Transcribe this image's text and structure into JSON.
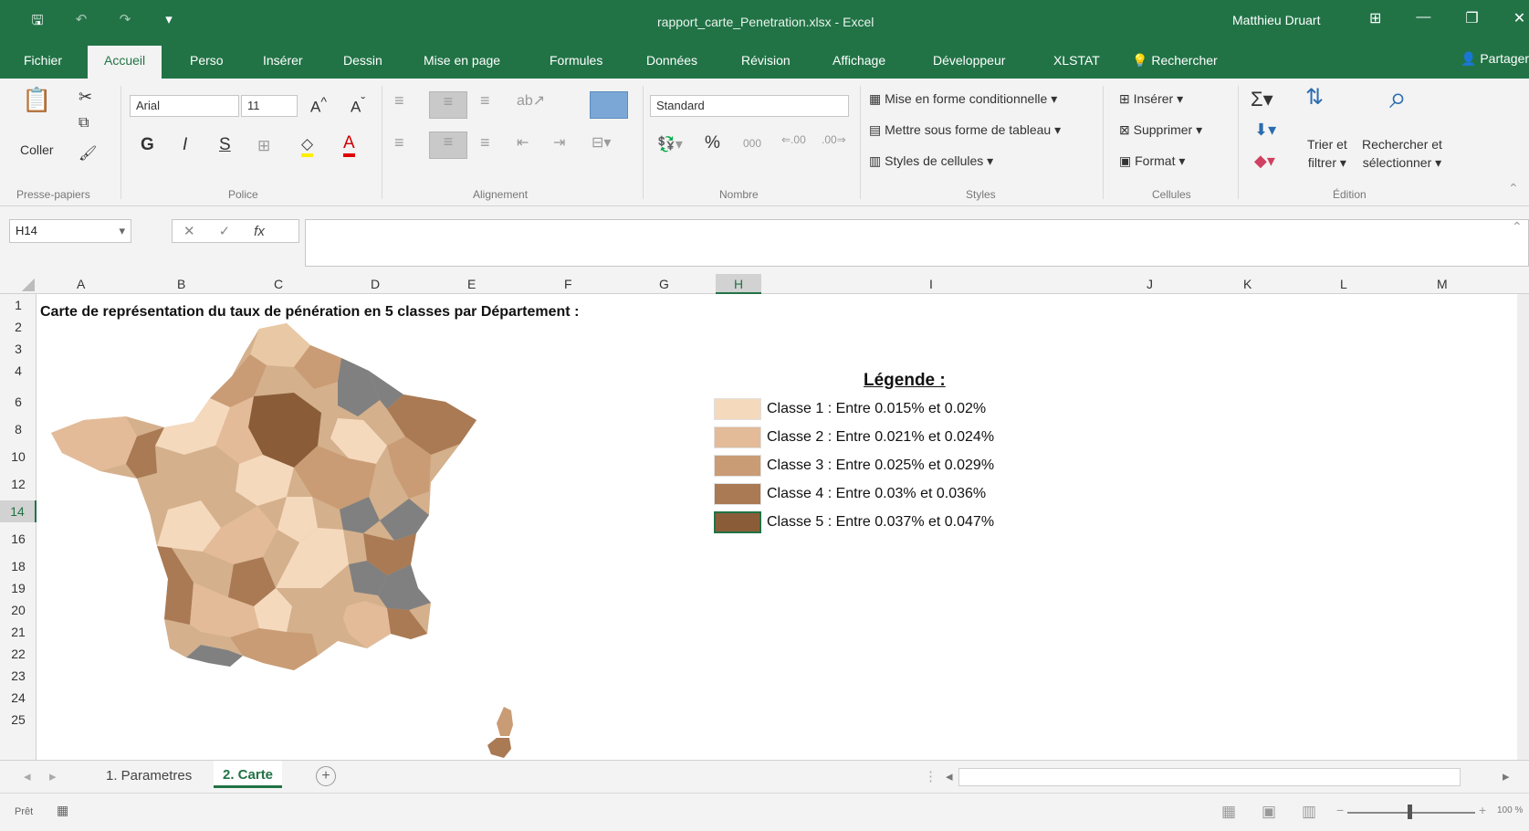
{
  "titlebar": {
    "document_title": "rapport_carte_Penetration.xlsx - Excel",
    "user_name": "Matthieu Druart",
    "qat_icons": [
      "save-icon",
      "undo-icon",
      "redo-icon",
      "customize-icon"
    ]
  },
  "menu": {
    "tabs": [
      "Fichier",
      "Accueil",
      "Perso",
      "Insérer",
      "Dessin",
      "Mise en page",
      "Formules",
      "Données",
      "Révision",
      "Affichage",
      "Développeur",
      "XLSTAT"
    ],
    "active_tab": "Accueil",
    "search_label": "Rechercher",
    "share_label": "Partager"
  },
  "ribbon": {
    "clipboard": {
      "paste_label": "Coller",
      "group_label": "Presse-papiers"
    },
    "font": {
      "name": "Arial",
      "size": "11",
      "bold": "G",
      "italic": "I",
      "underline": "S",
      "group_label": "Police"
    },
    "alignment": {
      "group_label": "Alignement"
    },
    "number": {
      "format": "Standard",
      "percent": "%",
      "thousands": "000",
      "group_label": "Nombre"
    },
    "styles": {
      "conditional": "Mise en forme conditionnelle",
      "as_table": "Mettre sous forme de tableau",
      "cell_styles": "Styles de cellules",
      "group_label": "Styles"
    },
    "cells": {
      "insert": "Insérer",
      "delete": "Supprimer",
      "format": "Format",
      "group_label": "Cellules"
    },
    "editing": {
      "sort_line1": "Trier et",
      "sort_line2": "filtrer",
      "find_line1": "Rechercher et",
      "find_line2": "sélectionner",
      "group_label": "Édition"
    }
  },
  "formula_bar": {
    "cell_ref": "H14",
    "formula": ""
  },
  "grid": {
    "columns": [
      "A",
      "B",
      "C",
      "D",
      "E",
      "F",
      "G",
      "H",
      "I",
      "J",
      "K",
      "L",
      "M"
    ],
    "rows": [
      "1",
      "2",
      "3",
      "4",
      "6",
      "8",
      "10",
      "12",
      "14",
      "16",
      "18",
      "19",
      "20",
      "21",
      "22",
      "23",
      "24",
      "25"
    ],
    "selected_row": "14",
    "title": "Carte de représentation du taux de pénération en 5 classes par Département :"
  },
  "legend": {
    "title": "Légende :",
    "items": [
      {
        "label": "Classe 1 : Entre 0.015% et 0.02%",
        "color": "#f5d9bd"
      },
      {
        "label": "Classe 2 : Entre 0.021% et 0.024%",
        "color": "#e3bb98"
      },
      {
        "label": "Classe 3 : Entre 0.025% et 0.029%",
        "color": "#c99c75"
      },
      {
        "label": "Classe 4 : Entre 0.03% et 0.036%",
        "color": "#a97a54"
      },
      {
        "label": "Classe 5 : Entre 0.037% et 0.047%",
        "color": "#8a5d38"
      }
    ]
  },
  "sheets": {
    "tabs": [
      "1. Parametres",
      "2. Carte"
    ],
    "active": "2. Carte"
  },
  "status": {
    "mode": "Prêt",
    "zoom": "100 %"
  }
}
